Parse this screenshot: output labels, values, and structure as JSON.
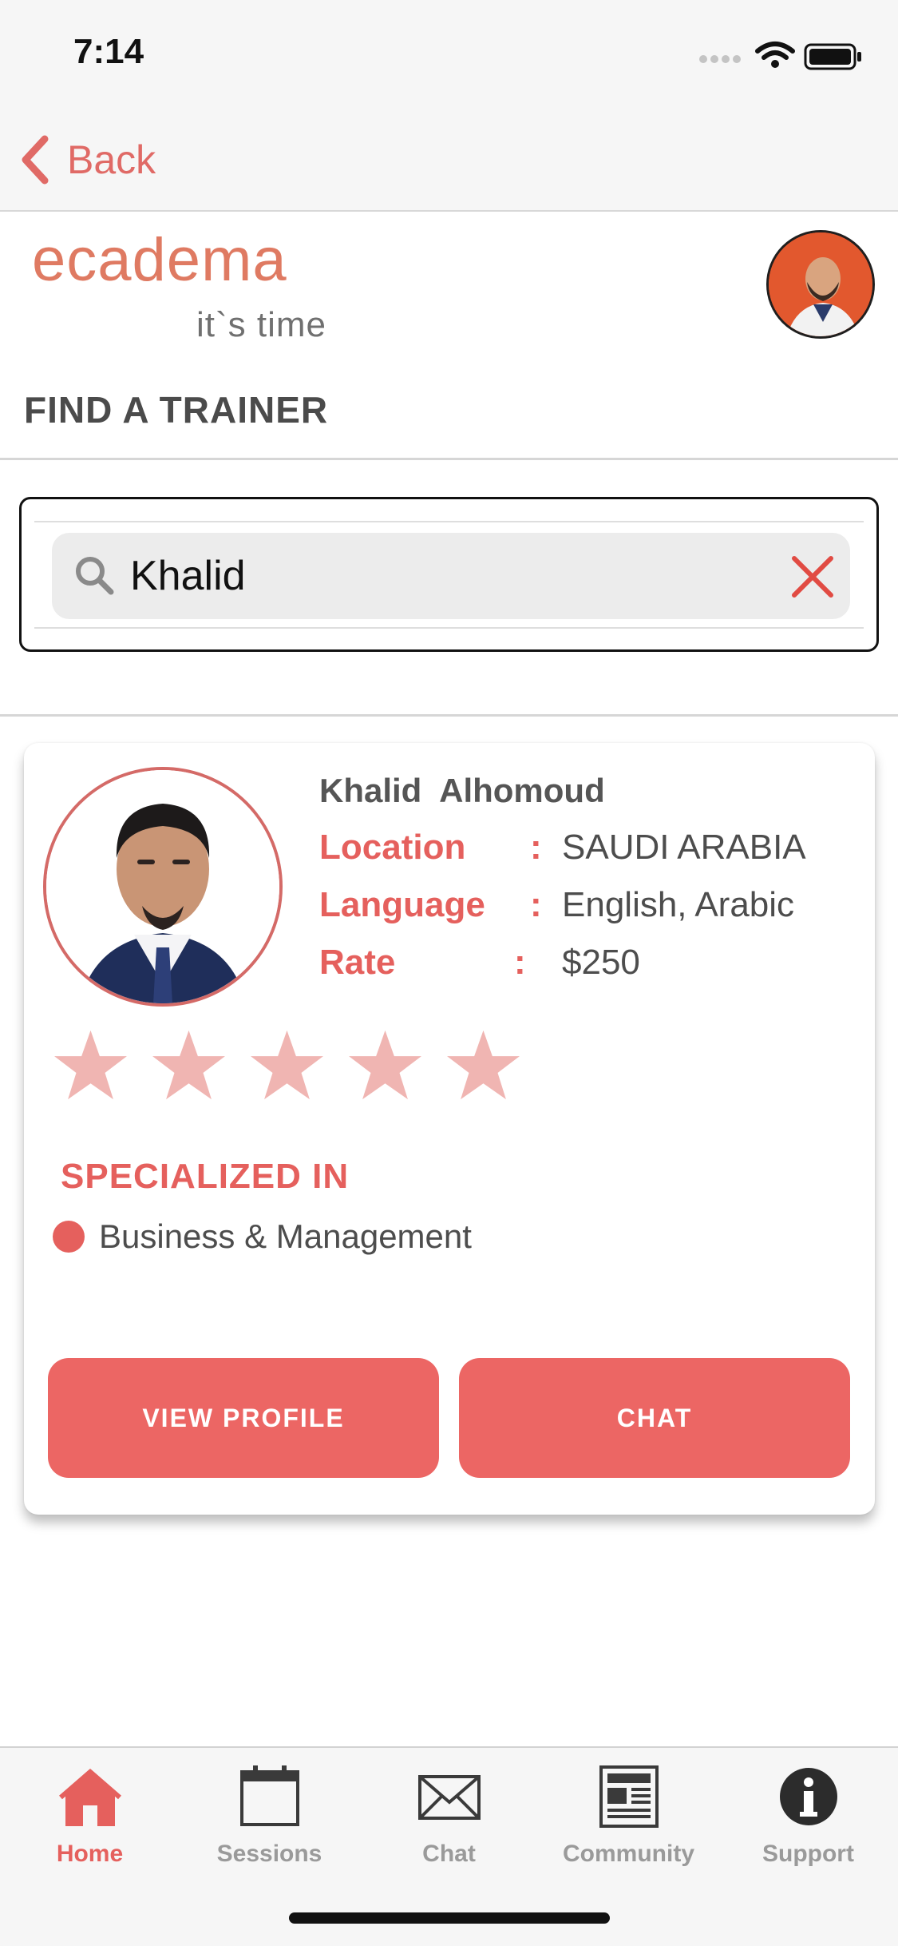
{
  "status_bar": {
    "time": "7:14"
  },
  "nav": {
    "back_label": "Back"
  },
  "brand": {
    "name": "ecadema",
    "tagline": "it`s time"
  },
  "page": {
    "title": "FIND A TRAINER"
  },
  "search": {
    "value": "Khalid",
    "placeholder": ""
  },
  "trainer": {
    "name": "Khalid  Alhomoud",
    "rows": [
      {
        "label": "Location",
        "value": "SAUDI ARABIA"
      },
      {
        "label": "Language",
        "value": "English, Arabic"
      },
      {
        "label": "Rate",
        "value": "$250"
      }
    ],
    "colon": ":",
    "rating": 0,
    "rating_max": 5,
    "specialized_title": "SPECIALIZED IN",
    "specializations": [
      "Business & Management"
    ],
    "view_profile_label": "VIEW PROFILE",
    "chat_label": "CHAT"
  },
  "tabs": [
    {
      "label": "Home",
      "icon": "home-icon",
      "active": true
    },
    {
      "label": "Sessions",
      "icon": "calendar-icon",
      "active": false
    },
    {
      "label": "Chat",
      "icon": "envelope-icon",
      "active": false
    },
    {
      "label": "Community",
      "icon": "newspaper-icon",
      "active": false
    },
    {
      "label": "Support",
      "icon": "info-icon",
      "active": false
    }
  ],
  "colors": {
    "accent": "#ec6664",
    "accent_text": "#e5605d",
    "star": "#f0b5b2",
    "tab_inactive": "#9a9a9a"
  }
}
